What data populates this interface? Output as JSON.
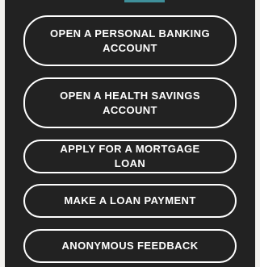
{
  "colors": {
    "panel_background": "#222222",
    "page_background": "#f2f1ee",
    "accent": "#3f8f9a",
    "button_border": "#ffffff",
    "button_text": "#ffffff"
  },
  "menu": {
    "buttons": [
      {
        "label": "OPEN A PERSONAL BANKING ACCOUNT"
      },
      {
        "label": "OPEN A HEALTH SAVINGS ACCOUNT"
      },
      {
        "label": "APPLY FOR A MORTGAGE LOAN"
      },
      {
        "label": "MAKE A LOAN PAYMENT"
      },
      {
        "label": "ANONYMOUS FEEDBACK"
      }
    ]
  }
}
